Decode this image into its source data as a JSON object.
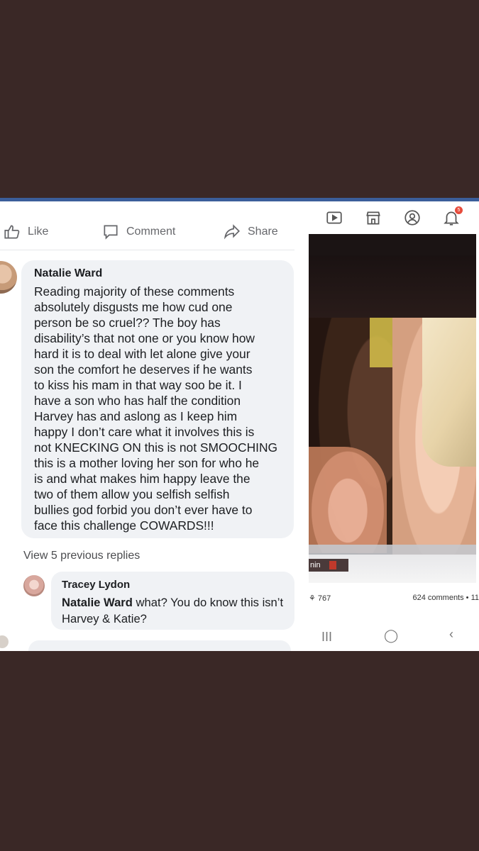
{
  "facebook": {
    "actions": {
      "like_label": "Like",
      "comment_label": "Comment",
      "share_label": "Share"
    },
    "comment1": {
      "author": "Natalie Ward",
      "text": "Reading majority of these comments\nabsolutely disgusts me how cud one\nperson be so cruel?? The boy has\ndisability’s that not one or you know how\nhard it is to deal with let alone give your\nson the comfort he deserves  if he wants\nto kiss his mam in that way soo be it. I\nhave a son who has half the condition\nHarvey has and aslong as I keep him\nhappy I don’t care what it involves this is\nnot KNECKING ON this is not SMOOCHING\nthis is a mother loving her son for who he\nis and what makes him happy leave the\ntwo of them allow you selfish selfish\nbullies god forbid you don’t ever have to\nface this challenge COWARDS!!!"
    },
    "view_replies": "View 5 previous replies",
    "reply": {
      "author": "Tracey Lydon",
      "mention": "Natalie Ward",
      "text": " what? You do know this isn’t Harvey & Katie?"
    }
  },
  "phone": {
    "nav_icons": [
      "video-icon",
      "marketplace-icon",
      "profile-icon",
      "notifications-icon"
    ],
    "notification_badge": "5",
    "channel_text": "nin",
    "likes_count": "767",
    "comments_text": "624 comments • 11",
    "softkeys": [
      "III",
      "◯",
      "‹"
    ]
  }
}
